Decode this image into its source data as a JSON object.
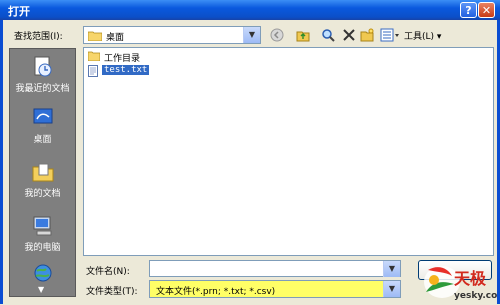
{
  "window": {
    "title": "打开",
    "help_label": "?",
    "close_label": "✕"
  },
  "toolbar": {
    "lookin_label": "查找范围(I):",
    "lookin_value": "桌面",
    "tools_label": "工具(L) ▾",
    "icons": [
      "back-icon",
      "up-folder-icon",
      "search-web-icon",
      "delete-icon",
      "new-folder-icon",
      "views-icon"
    ]
  },
  "places": [
    {
      "label": "我最近的文档",
      "icon": "recent-docs-icon"
    },
    {
      "label": "桌面",
      "icon": "desktop-icon"
    },
    {
      "label": "我的文档",
      "icon": "my-documents-icon"
    },
    {
      "label": "我的电脑",
      "icon": "my-computer-icon"
    },
    {
      "label": "",
      "icon": "network-icon"
    }
  ],
  "files": [
    {
      "name": "工作目录",
      "type": "folder"
    },
    {
      "name": "test.txt",
      "type": "file"
    }
  ],
  "filename": {
    "label": "文件名(N):",
    "value": ""
  },
  "filetype": {
    "label": "文件类型(T):",
    "value": "文本文件(*.prn; *.txt; *.csv)"
  },
  "watermark": {
    "brand": "天极",
    "site": "yesky.com"
  },
  "colors": {
    "titlebar": "#0A59DE",
    "places_bg": "#7F7F7F",
    "selection": "#316AC5",
    "filetype_highlight": "#FFFF66"
  }
}
